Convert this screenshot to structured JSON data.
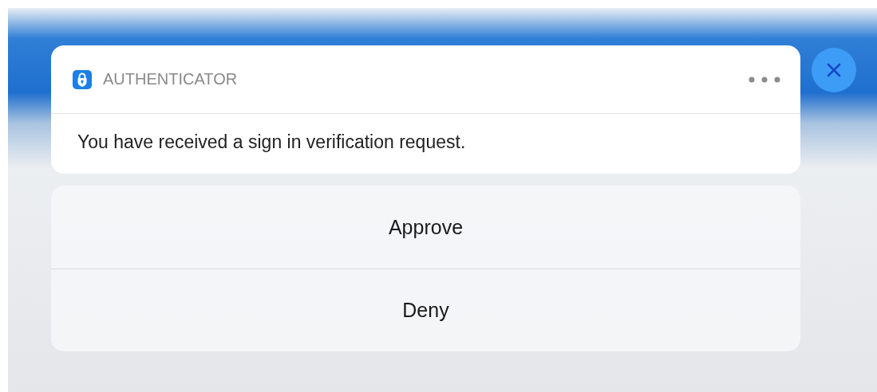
{
  "notification": {
    "app_name": "AUTHENTICATOR",
    "message": "You have received a sign in verification request."
  },
  "actions": [
    {
      "label": "Approve"
    },
    {
      "label": "Deny"
    }
  ]
}
